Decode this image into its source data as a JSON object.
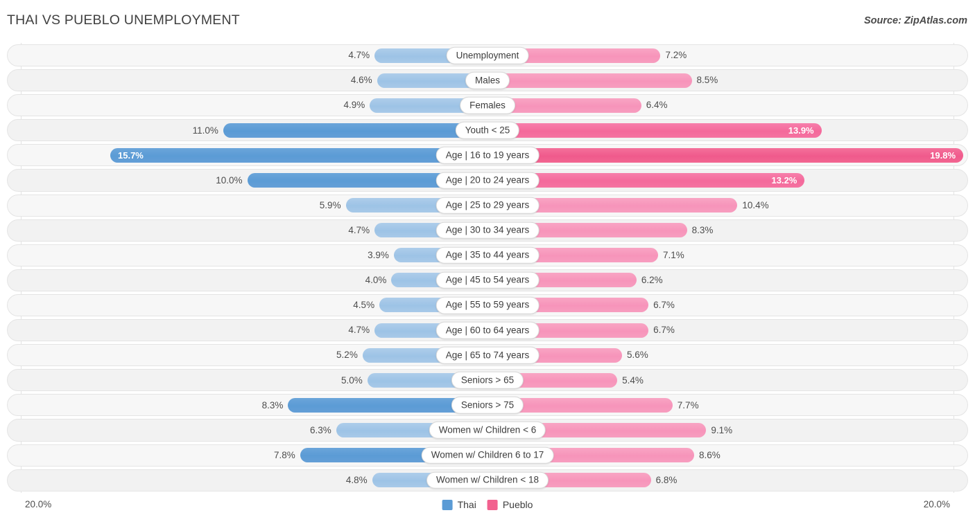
{
  "header": {
    "title": "THAI VS PUEBLO UNEMPLOYMENT",
    "source": "Source: ZipAtlas.com"
  },
  "footer": {
    "axis_max_left": "20.0%",
    "axis_max_right": "20.0%",
    "legend": [
      {
        "label": "Thai",
        "color": "#5b9bd5"
      },
      {
        "label": "Pueblo",
        "color": "#f2618f"
      }
    ]
  },
  "chart_data": {
    "type": "bar",
    "subtype": "diverging-horizontal-bar",
    "title": "THAI VS PUEBLO UNEMPLOYMENT",
    "xlabel": "",
    "ylabel": "",
    "xlim": [
      -20.0,
      20.0
    ],
    "axis_max": 20.0,
    "unit": "%",
    "grid": false,
    "legend_position": "bottom-center",
    "categories": [
      "Unemployment",
      "Males",
      "Females",
      "Youth < 25",
      "Age | 16 to 19 years",
      "Age | 20 to 24 years",
      "Age | 25 to 29 years",
      "Age | 30 to 34 years",
      "Age | 35 to 44 years",
      "Age | 45 to 54 years",
      "Age | 55 to 59 years",
      "Age | 60 to 64 years",
      "Age | 65 to 74 years",
      "Seniors > 65",
      "Seniors > 75",
      "Women w/ Children < 6",
      "Women w/ Children 6 to 17",
      "Women w/ Children < 18"
    ],
    "series": [
      {
        "name": "Thai",
        "color": "#5b9bd5",
        "side": "left",
        "values": [
          4.7,
          4.6,
          4.9,
          11.0,
          15.7,
          10.0,
          5.9,
          4.7,
          3.9,
          4.0,
          4.5,
          4.7,
          5.2,
          5.0,
          8.3,
          6.3,
          7.8,
          4.8
        ],
        "labels": [
          "4.7%",
          "4.6%",
          "4.9%",
          "11.0%",
          "15.7%",
          "10.0%",
          "5.9%",
          "4.7%",
          "3.9%",
          "4.0%",
          "4.5%",
          "4.7%",
          "5.2%",
          "5.0%",
          "8.3%",
          "6.3%",
          "7.8%",
          "4.8%"
        ]
      },
      {
        "name": "Pueblo",
        "color": "#f2618f",
        "side": "right",
        "values": [
          7.2,
          8.5,
          6.4,
          13.9,
          19.8,
          13.2,
          10.4,
          8.3,
          7.1,
          6.2,
          6.7,
          6.7,
          5.6,
          5.4,
          7.7,
          9.1,
          8.6,
          6.8
        ],
        "labels": [
          "7.2%",
          "8.5%",
          "6.4%",
          "13.9%",
          "19.8%",
          "13.2%",
          "10.4%",
          "8.3%",
          "7.1%",
          "6.2%",
          "6.7%",
          "6.7%",
          "5.6%",
          "5.4%",
          "7.7%",
          "9.1%",
          "8.6%",
          "6.8%"
        ]
      }
    ],
    "rows": [
      {
        "label": "Unemployment",
        "left": 4.7,
        "left_label": "4.7%",
        "right": 7.2,
        "right_label": "7.2%",
        "left_style": "light",
        "right_style": "light",
        "left_inside": false,
        "right_inside": false
      },
      {
        "label": "Males",
        "left": 4.6,
        "left_label": "4.6%",
        "right": 8.5,
        "right_label": "8.5%",
        "left_style": "light",
        "right_style": "light",
        "left_inside": false,
        "right_inside": false
      },
      {
        "label": "Females",
        "left": 4.9,
        "left_label": "4.9%",
        "right": 6.4,
        "right_label": "6.4%",
        "left_style": "light",
        "right_style": "light",
        "left_inside": false,
        "right_inside": false
      },
      {
        "label": "Youth < 25",
        "left": 11.0,
        "left_label": "11.0%",
        "right": 13.9,
        "right_label": "13.9%",
        "left_style": "strong",
        "right_style": "mid",
        "left_inside": false,
        "right_inside": true
      },
      {
        "label": "Age | 16 to 19 years",
        "left": 15.7,
        "left_label": "15.7%",
        "right": 19.8,
        "right_label": "19.8%",
        "left_style": "strong",
        "right_style": "strong",
        "left_inside": true,
        "right_inside": true
      },
      {
        "label": "Age | 20 to 24 years",
        "left": 10.0,
        "left_label": "10.0%",
        "right": 13.2,
        "right_label": "13.2%",
        "left_style": "strong",
        "right_style": "mid",
        "left_inside": false,
        "right_inside": true
      },
      {
        "label": "Age | 25 to 29 years",
        "left": 5.9,
        "left_label": "5.9%",
        "right": 10.4,
        "right_label": "10.4%",
        "left_style": "light",
        "right_style": "light",
        "left_inside": false,
        "right_inside": false
      },
      {
        "label": "Age | 30 to 34 years",
        "left": 4.7,
        "left_label": "4.7%",
        "right": 8.3,
        "right_label": "8.3%",
        "left_style": "light",
        "right_style": "light",
        "left_inside": false,
        "right_inside": false
      },
      {
        "label": "Age | 35 to 44 years",
        "left": 3.9,
        "left_label": "3.9%",
        "right": 7.1,
        "right_label": "7.1%",
        "left_style": "light",
        "right_style": "light",
        "left_inside": false,
        "right_inside": false
      },
      {
        "label": "Age | 45 to 54 years",
        "left": 4.0,
        "left_label": "4.0%",
        "right": 6.2,
        "right_label": "6.2%",
        "left_style": "light",
        "right_style": "light",
        "left_inside": false,
        "right_inside": false
      },
      {
        "label": "Age | 55 to 59 years",
        "left": 4.5,
        "left_label": "4.5%",
        "right": 6.7,
        "right_label": "6.7%",
        "left_style": "light",
        "right_style": "light",
        "left_inside": false,
        "right_inside": false
      },
      {
        "label": "Age | 60 to 64 years",
        "left": 4.7,
        "left_label": "4.7%",
        "right": 6.7,
        "right_label": "6.7%",
        "left_style": "light",
        "right_style": "light",
        "left_inside": false,
        "right_inside": false
      },
      {
        "label": "Age | 65 to 74 years",
        "left": 5.2,
        "left_label": "5.2%",
        "right": 5.6,
        "right_label": "5.6%",
        "left_style": "light",
        "right_style": "light",
        "left_inside": false,
        "right_inside": false
      },
      {
        "label": "Seniors > 65",
        "left": 5.0,
        "left_label": "5.0%",
        "right": 5.4,
        "right_label": "5.4%",
        "left_style": "light",
        "right_style": "light",
        "left_inside": false,
        "right_inside": false
      },
      {
        "label": "Seniors > 75",
        "left": 8.3,
        "left_label": "8.3%",
        "right": 7.7,
        "right_label": "7.7%",
        "left_style": "strong",
        "right_style": "light",
        "left_inside": false,
        "right_inside": false
      },
      {
        "label": "Women w/ Children < 6",
        "left": 6.3,
        "left_label": "6.3%",
        "right": 9.1,
        "right_label": "9.1%",
        "left_style": "light",
        "right_style": "light",
        "left_inside": false,
        "right_inside": false
      },
      {
        "label": "Women w/ Children 6 to 17",
        "left": 7.8,
        "left_label": "7.8%",
        "right": 8.6,
        "right_label": "8.6%",
        "left_style": "strong",
        "right_style": "light",
        "left_inside": false,
        "right_inside": false
      },
      {
        "label": "Women w/ Children < 18",
        "left": 4.8,
        "left_label": "4.8%",
        "right": 6.8,
        "right_label": "6.8%",
        "left_style": "light",
        "right_style": "light",
        "left_inside": false,
        "right_inside": false
      }
    ]
  }
}
